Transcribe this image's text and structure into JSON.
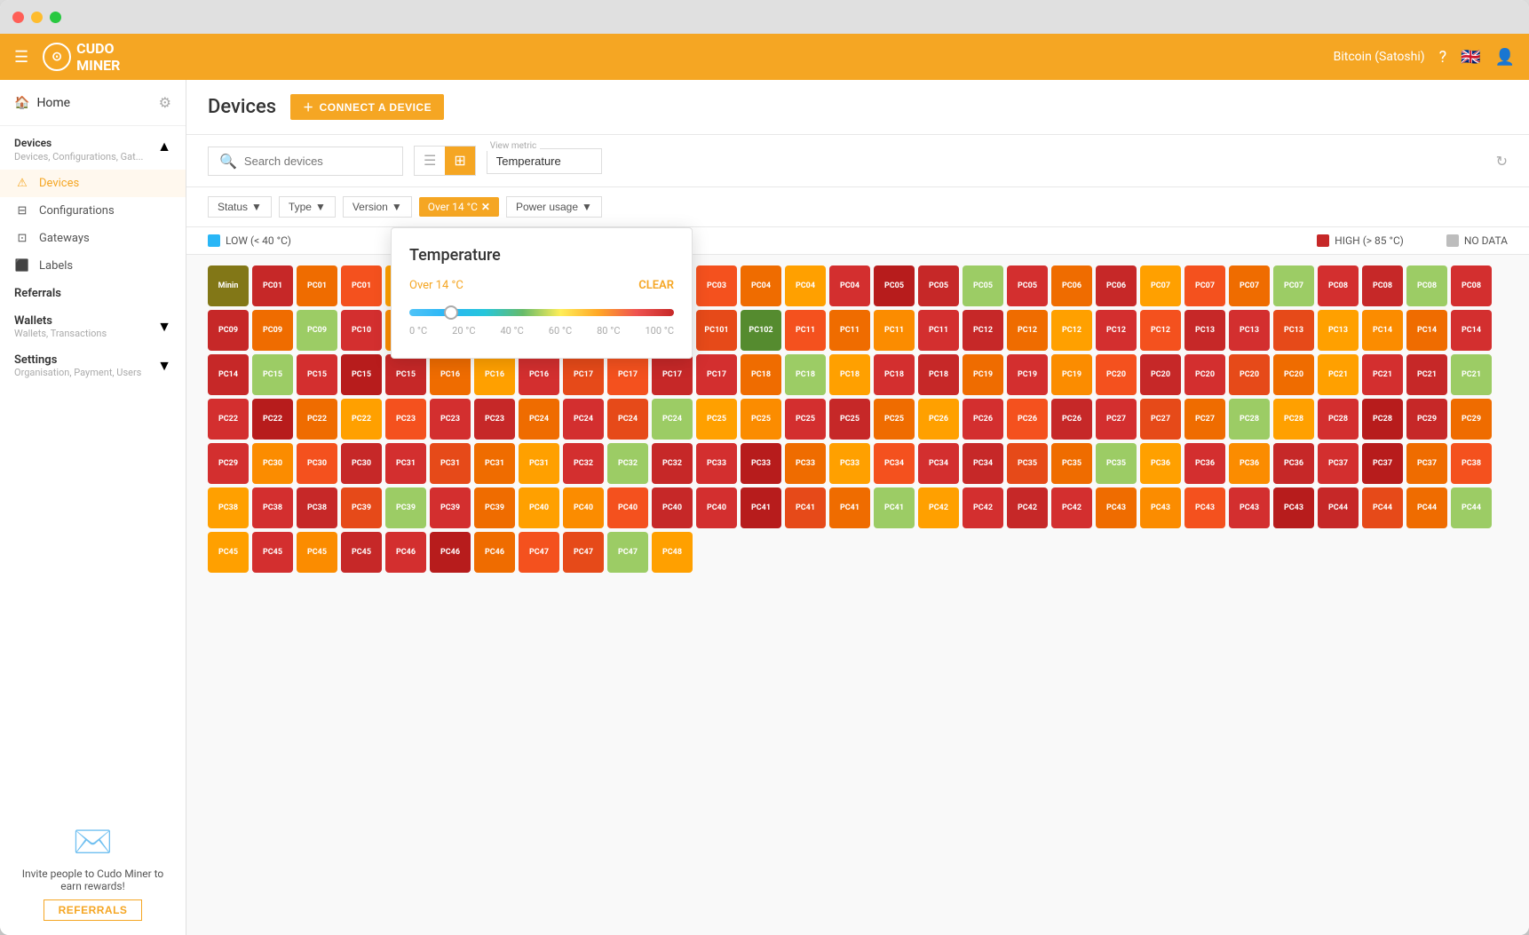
{
  "window": {
    "title": "Cudo Miner"
  },
  "topnav": {
    "logo_text": "CUDO\nMINER",
    "currency": "Bitcoin (Satoshi)"
  },
  "sidebar": {
    "home_label": "Home",
    "devices_section": {
      "title": "Devices",
      "subtitle": "Devices, Configurations, Gat..."
    },
    "nav_items": [
      {
        "label": "Devices",
        "active": true
      },
      {
        "label": "Configurations",
        "active": false
      },
      {
        "label": "Gateways",
        "active": false
      },
      {
        "label": "Labels",
        "active": false
      }
    ],
    "groups": [
      {
        "label": "Referrals"
      },
      {
        "label": "Wallets",
        "sub": "Wallets, Transactions"
      },
      {
        "label": "Settings",
        "sub": "Organisation, Payment, Users"
      }
    ],
    "promo_text": "Invite people to Cudo Miner to earn rewards!",
    "referrals_btn": "REFERRALS"
  },
  "page": {
    "title": "Devices",
    "connect_btn": "CONNECT A DEVICE"
  },
  "toolbar": {
    "search_placeholder": "Search devices",
    "view_metric_label": "View metric",
    "view_metric_value": "Temperature"
  },
  "filters": {
    "status_label": "Status",
    "type_label": "Type",
    "version_label": "Version",
    "active_filter": "Over 14 °C",
    "power_usage_label": "Power usage"
  },
  "legend": {
    "low_label": "LOW (< 40 °C)",
    "high_label": "HIGH (> 85 °C)",
    "no_data_label": "NO DATA",
    "low_color": "#29b6f6",
    "high_color": "#c62828",
    "no_data_color": "#bdbdbd"
  },
  "temp_popup": {
    "title": "Temperature",
    "filter_label": "Over 14 °C",
    "clear_label": "CLEAR",
    "slider_min": 0,
    "slider_max": 100,
    "slider_value": 14,
    "labels": [
      "0 °C",
      "20 °C",
      "40 °C",
      "60 °C",
      "80 °C",
      "100 °C"
    ]
  },
  "devices": {
    "colors": {
      "red_dark": "#b71c1c",
      "red": "#c62828",
      "red2": "#d32f2f",
      "orange_dark": "#bf360c",
      "orange": "#e64a19",
      "orange2": "#f4511e",
      "orange3": "#ff7043",
      "yellow_dark": "#e65100",
      "yellow": "#ef6c00",
      "yellow2": "#f57c00",
      "yellow3": "#fb8c00",
      "amber": "#ff8f00",
      "lime": "#827717",
      "green": "#558b2f",
      "green2": "#33691e"
    }
  }
}
